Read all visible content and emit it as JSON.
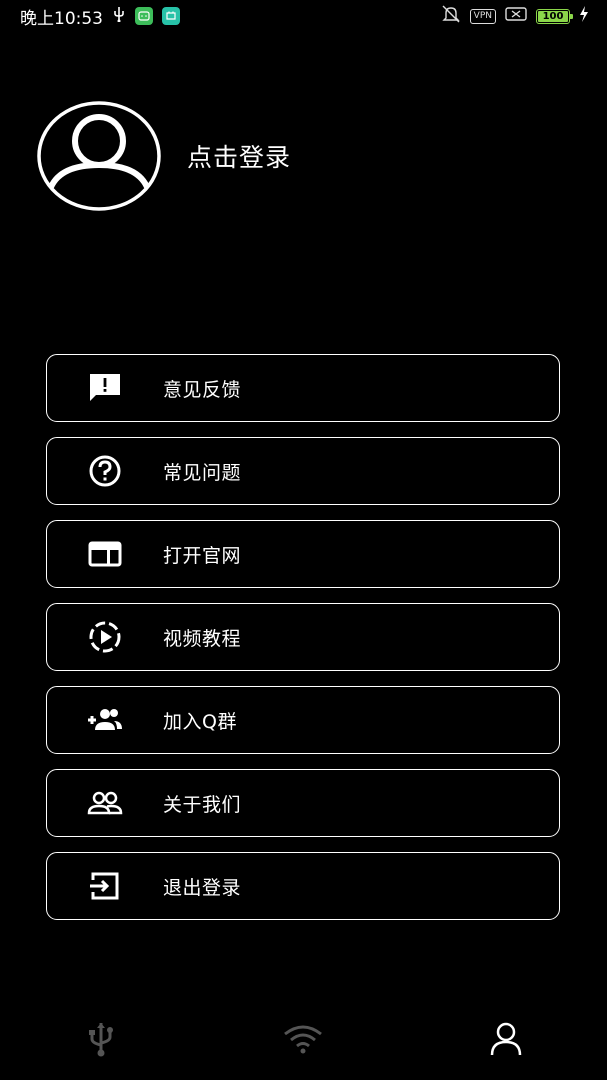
{
  "status_bar": {
    "time": "晚上10:53",
    "vpn_label": "VPN",
    "battery_level": "100",
    "battery_color": "#8bd64a",
    "icons": [
      "usb-icon",
      "app-notification-icon",
      "app-notification-icon",
      "mute-icon",
      "vpn-icon",
      "sim-off-icon",
      "battery-icon",
      "charging-icon"
    ]
  },
  "profile": {
    "avatar_icon": "user-avatar-icon",
    "login_label": "点击登录"
  },
  "menu": {
    "items": [
      {
        "label": "意见反馈",
        "icon": "feedback-icon"
      },
      {
        "label": "常见问题",
        "icon": "help-circle-icon"
      },
      {
        "label": "打开官网",
        "icon": "web-window-icon"
      },
      {
        "label": "视频教程",
        "icon": "play-circle-icon"
      },
      {
        "label": "加入Q群",
        "icon": "group-add-icon"
      },
      {
        "label": "关于我们",
        "icon": "people-icon"
      },
      {
        "label": "退出登录",
        "icon": "exit-icon"
      }
    ]
  },
  "bottom_nav": {
    "items": [
      {
        "icon": "usb-icon",
        "active": false
      },
      {
        "icon": "wifi-icon",
        "active": false
      },
      {
        "icon": "person-icon",
        "active": true
      }
    ],
    "active_color": "#ffffff",
    "inactive_color": "#555555"
  }
}
